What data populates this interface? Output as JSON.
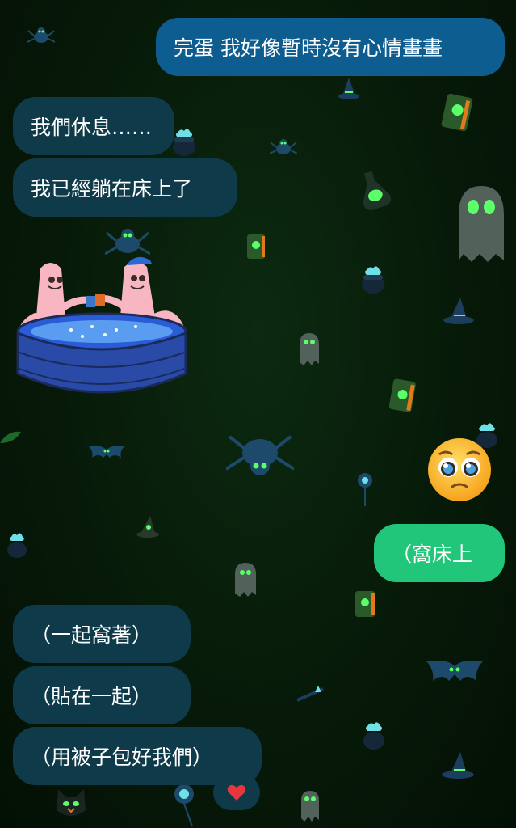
{
  "messages": [
    {
      "id": "m1",
      "side": "out",
      "text": "完蛋 我好像暫時沒有心情畫畫"
    },
    {
      "id": "m2",
      "side": "in",
      "text": "我們休息……"
    },
    {
      "id": "m3",
      "side": "in",
      "text": "我已經躺在床上了"
    },
    {
      "id": "m4",
      "side": "in",
      "type": "sticker",
      "sticker": "two-characters-in-hot-tub"
    },
    {
      "id": "m5",
      "side": "out",
      "type": "emoji",
      "emoji": "pleading-face"
    },
    {
      "id": "m6",
      "side": "out",
      "text": "（窩床上"
    },
    {
      "id": "m7",
      "side": "in",
      "text": "（一起窩著）"
    },
    {
      "id": "m8",
      "side": "in",
      "text": "（貼在一起）"
    },
    {
      "id": "m9",
      "side": "in",
      "text": "（用被子包好我們）",
      "reaction": "heart"
    }
  ],
  "colors": {
    "incoming_bubble": "#0f3a4a",
    "outgoing_bubble_blue": "#0e5d91",
    "outgoing_bubble_green": "#22c67a",
    "heart": "#e8363f",
    "background": "#071a09"
  },
  "decorations": [
    "spider-icon",
    "ghost-icon",
    "witch-hat-icon",
    "cauldron-icon",
    "spellbook-icon",
    "bat-icon",
    "potion-bottle-icon",
    "black-cat-icon"
  ]
}
